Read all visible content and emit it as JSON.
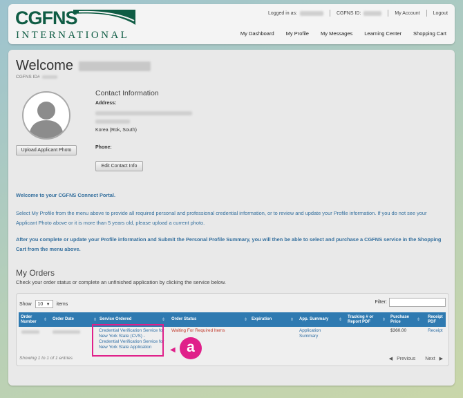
{
  "header": {
    "logo_main": "CGFNS",
    "logo_sub": "INTERNATIONAL",
    "logged_in_label": "Logged in as:",
    "cgfns_id_label": "CGFNS ID:",
    "my_account": "My Account",
    "logout": "Logout",
    "brand_color": "#0f5c44",
    "nav": [
      "My Dashboard",
      "My Profile",
      "My Messages",
      "Learning Center",
      "Shopping Cart"
    ]
  },
  "profile": {
    "welcome": "Welcome",
    "id_label": "CGFNS ID#",
    "upload_photo_button": "Upload Applicant Photo",
    "contact_title": "Contact Information",
    "address_label": "Address:",
    "country": "Korea (Rok, South)",
    "phone_label": "Phone:",
    "edit_contact_button": "Edit Contact Info"
  },
  "messages": {
    "welcome": "Welcome to your CGFNS Connect Portal.",
    "instructions": "Select My Profile from the menu above to provide all required personal and professional credential information, or to review and update your Profile information. If you do not see your Applicant Photo above or it is more than 5 years old, please upload a current photo.",
    "after_submit": "After you complete or update your Profile information and Submit the Personal Profile Summary, you will then be able to select and purchase a CGFNS service in the Shopping Cart from the menu above.",
    "text_color": "#35709e"
  },
  "orders": {
    "title": "My Orders",
    "subtitle": "Check your order status or complete an unfinished application by clicking the service below.",
    "show_label": "Show",
    "page_size": "10",
    "items_label": "items",
    "filter_label": "Filter:",
    "header_color": "#2f7ab1",
    "columns": [
      "Order Number",
      "Order Date",
      "Service Ordered",
      "Order Status",
      "Expiration",
      "App. Summary",
      "Tracking # or Report PDF",
      "Purchase Price",
      "Receipt PDF"
    ],
    "rows": [
      {
        "service": "Credential Verification Service for New York State (CVS) - Credential Verification Service for New York State Application",
        "status": "Waiting For Required Items",
        "app_summary": "Application Summary",
        "price": "$360.00",
        "receipt": "Receipt"
      }
    ],
    "info": "Showing 1 to 1 of 1 entries",
    "previous": "Previous",
    "next": "Next"
  },
  "annotation": {
    "label": "a",
    "color": "#e0208a"
  }
}
